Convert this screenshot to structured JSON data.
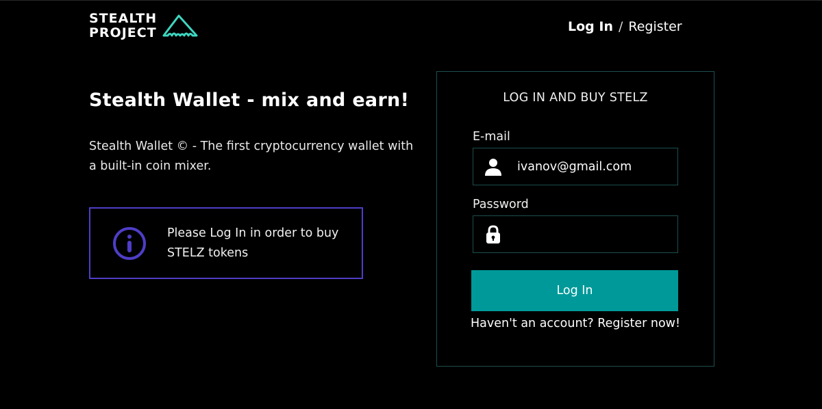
{
  "header": {
    "logo_line1": "STEALTH",
    "logo_line2": "PROJECT",
    "logo_icon": "stealth-bomber-icon",
    "login_label": "Log In",
    "separator": "/",
    "register_label": "Register"
  },
  "hero": {
    "title": "Stealth Wallet - mix and earn!",
    "description": "Stealth Wallet © - The first cryptocurrency wallet with a built-in coin mixer."
  },
  "info_box": {
    "icon": "info-icon",
    "text": "Please Log In in order to buy STELZ tokens"
  },
  "login_form": {
    "title": "LOG IN AND BUY STELZ",
    "email_label": "E-mail",
    "email_value": "ivanov@gmail.com",
    "email_icon": "user-icon",
    "password_label": "Password",
    "password_value": "",
    "password_icon": "lock-icon",
    "submit_label": "Log In",
    "register_prompt": "Haven't an account? Register now!"
  },
  "colors": {
    "background": "#000000",
    "accent_teal": "#009999",
    "logo_teal": "#3ed6c0",
    "info_border": "#4e3ec7",
    "card_border": "#1d4f4f"
  }
}
